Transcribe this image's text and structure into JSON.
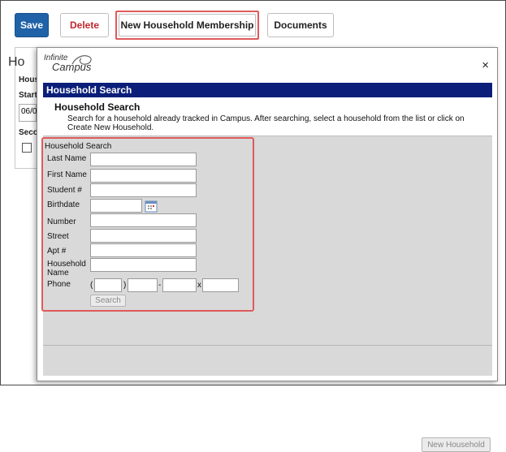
{
  "toolbar": {
    "save_label": "Save",
    "delete_label": "Delete",
    "new_household_membership_label": "New Household Membership",
    "documents_label": "Documents"
  },
  "background_panel": {
    "title": "Ho",
    "label_house": "Hous",
    "label_start": "Start",
    "start_value": "06/0",
    "label_seco": "Seco"
  },
  "dialog": {
    "logo_line1": "Infinite",
    "logo_line2": "Campus",
    "close_glyph": "×",
    "header_bar": "Household Search",
    "info_title": "Household Search",
    "info_text": "Search for a household already tracked in Campus. After searching, select a household from the list or click on Create New Household.",
    "form": {
      "title": "Household Search",
      "fields": {
        "last_name": "Last Name",
        "first_name": "First Name",
        "student_num": "Student #",
        "birthdate": "Birthdate",
        "number": "Number",
        "street": "Street",
        "apt": "Apt #",
        "household_name_1": "Household",
        "household_name_2": "Name",
        "phone": "Phone"
      },
      "phone_open_paren": "(",
      "phone_close_paren": ")",
      "phone_dash": "-",
      "phone_ext": "x",
      "search_label": "Search"
    },
    "new_household_label": "New Household"
  },
  "colors": {
    "save_bg": "#1f62a7",
    "delete_text": "#c0272d",
    "highlight_border": "#e05a5a",
    "header_bar_bg": "#0b1f7a",
    "gray_area": "#d9d9d9"
  },
  "icons": {
    "calendar": "calendar-icon",
    "close": "close-icon",
    "logo": "infinite-campus-logo"
  }
}
